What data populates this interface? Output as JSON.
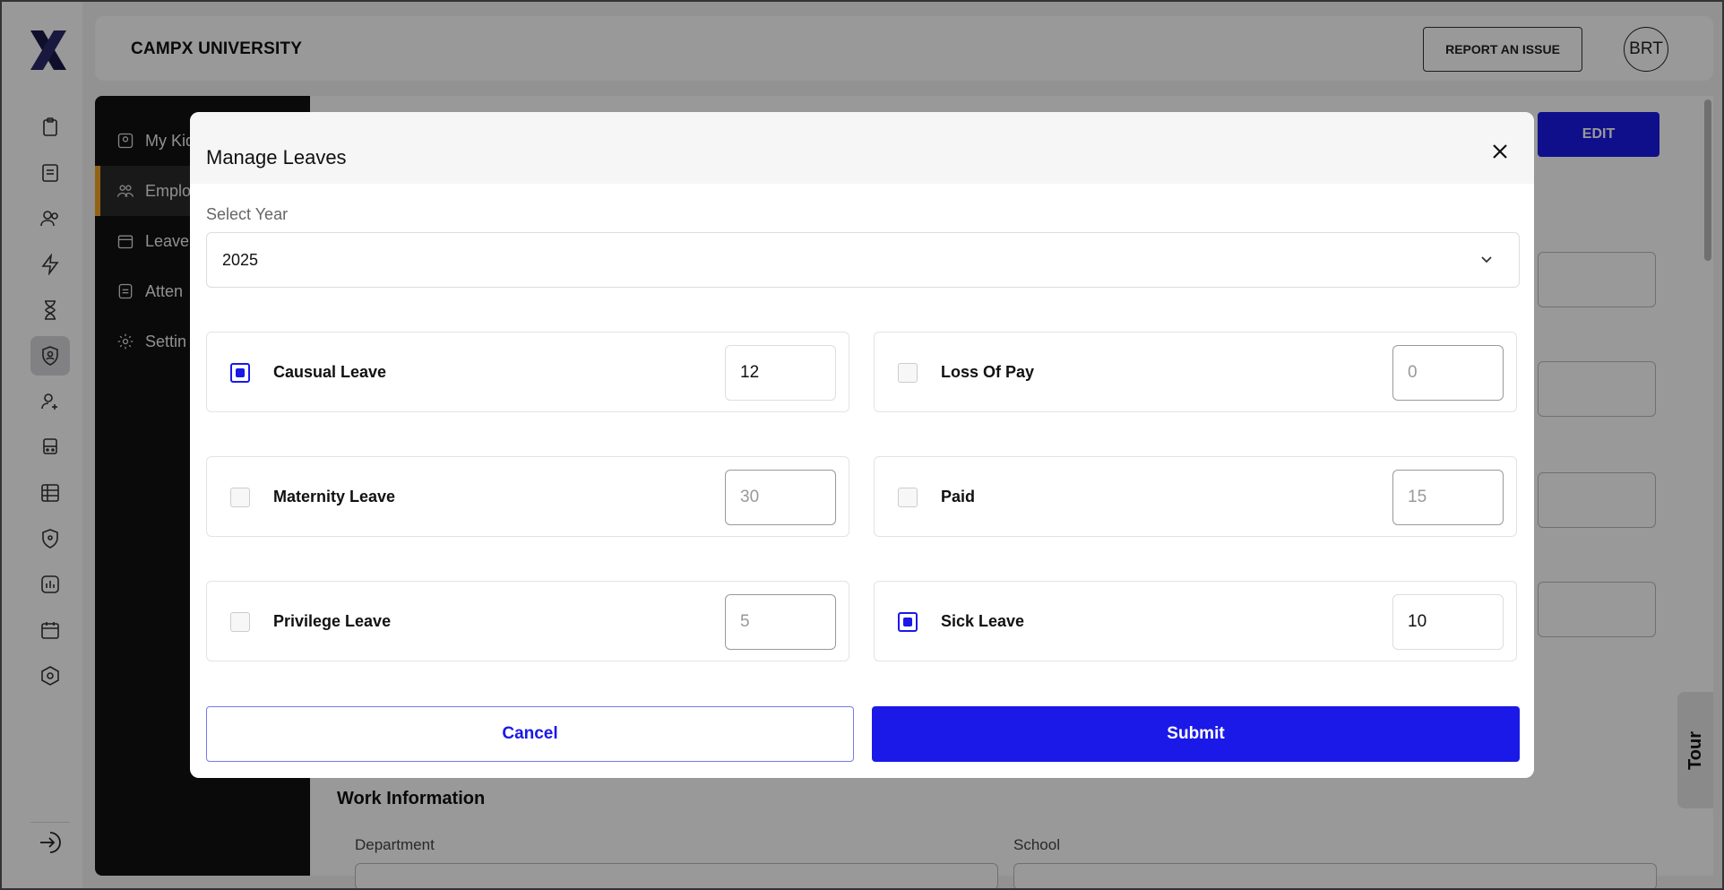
{
  "app": {
    "university": "CAMPX UNIVERSITY",
    "report_button": "REPORT AN ISSUE",
    "avatar_initials": "BRT",
    "tour_label": "Tour"
  },
  "rail": {
    "icons": [
      "clipboard-icon",
      "document-icon",
      "users-icon",
      "lightning-icon",
      "hourglass-icon",
      "shield-user-icon",
      "user-add-icon",
      "bus-icon",
      "spreadsheet-icon",
      "location-shield-icon",
      "chart-icon",
      "calendar-icon",
      "hexagon-gear-icon"
    ],
    "active_index": 5
  },
  "subnav": {
    "items": [
      {
        "label": "My Kid",
        "icon": "kid-icon"
      },
      {
        "label": "Emplo",
        "icon": "employees-icon"
      },
      {
        "label": "Leave",
        "icon": "leave-icon"
      },
      {
        "label": "Atten",
        "icon": "attendance-icon"
      },
      {
        "label": "Settin",
        "icon": "settings-icon"
      }
    ],
    "active_index": 1
  },
  "main": {
    "edit_button": "EDIT",
    "work_info_title": "Work Information",
    "department_label": "Department",
    "school_label": "School"
  },
  "modal": {
    "title": "Manage Leaves",
    "select_year_label": "Select Year",
    "selected_year": "2025",
    "leaves": [
      {
        "name": "Causual Leave",
        "value": "12",
        "checked": true
      },
      {
        "name": "Loss Of Pay",
        "value": "0",
        "checked": false
      },
      {
        "name": "Maternity Leave",
        "value": "30",
        "checked": false
      },
      {
        "name": "Paid",
        "value": "15",
        "checked": false
      },
      {
        "name": "Privilege Leave",
        "value": "5",
        "checked": false
      },
      {
        "name": "Sick Leave",
        "value": "10",
        "checked": true
      }
    ],
    "cancel_label": "Cancel",
    "submit_label": "Submit"
  },
  "colors": {
    "accent": "#1a19e8",
    "highlight": "#f5a623",
    "logo": "#1a1a4a"
  }
}
